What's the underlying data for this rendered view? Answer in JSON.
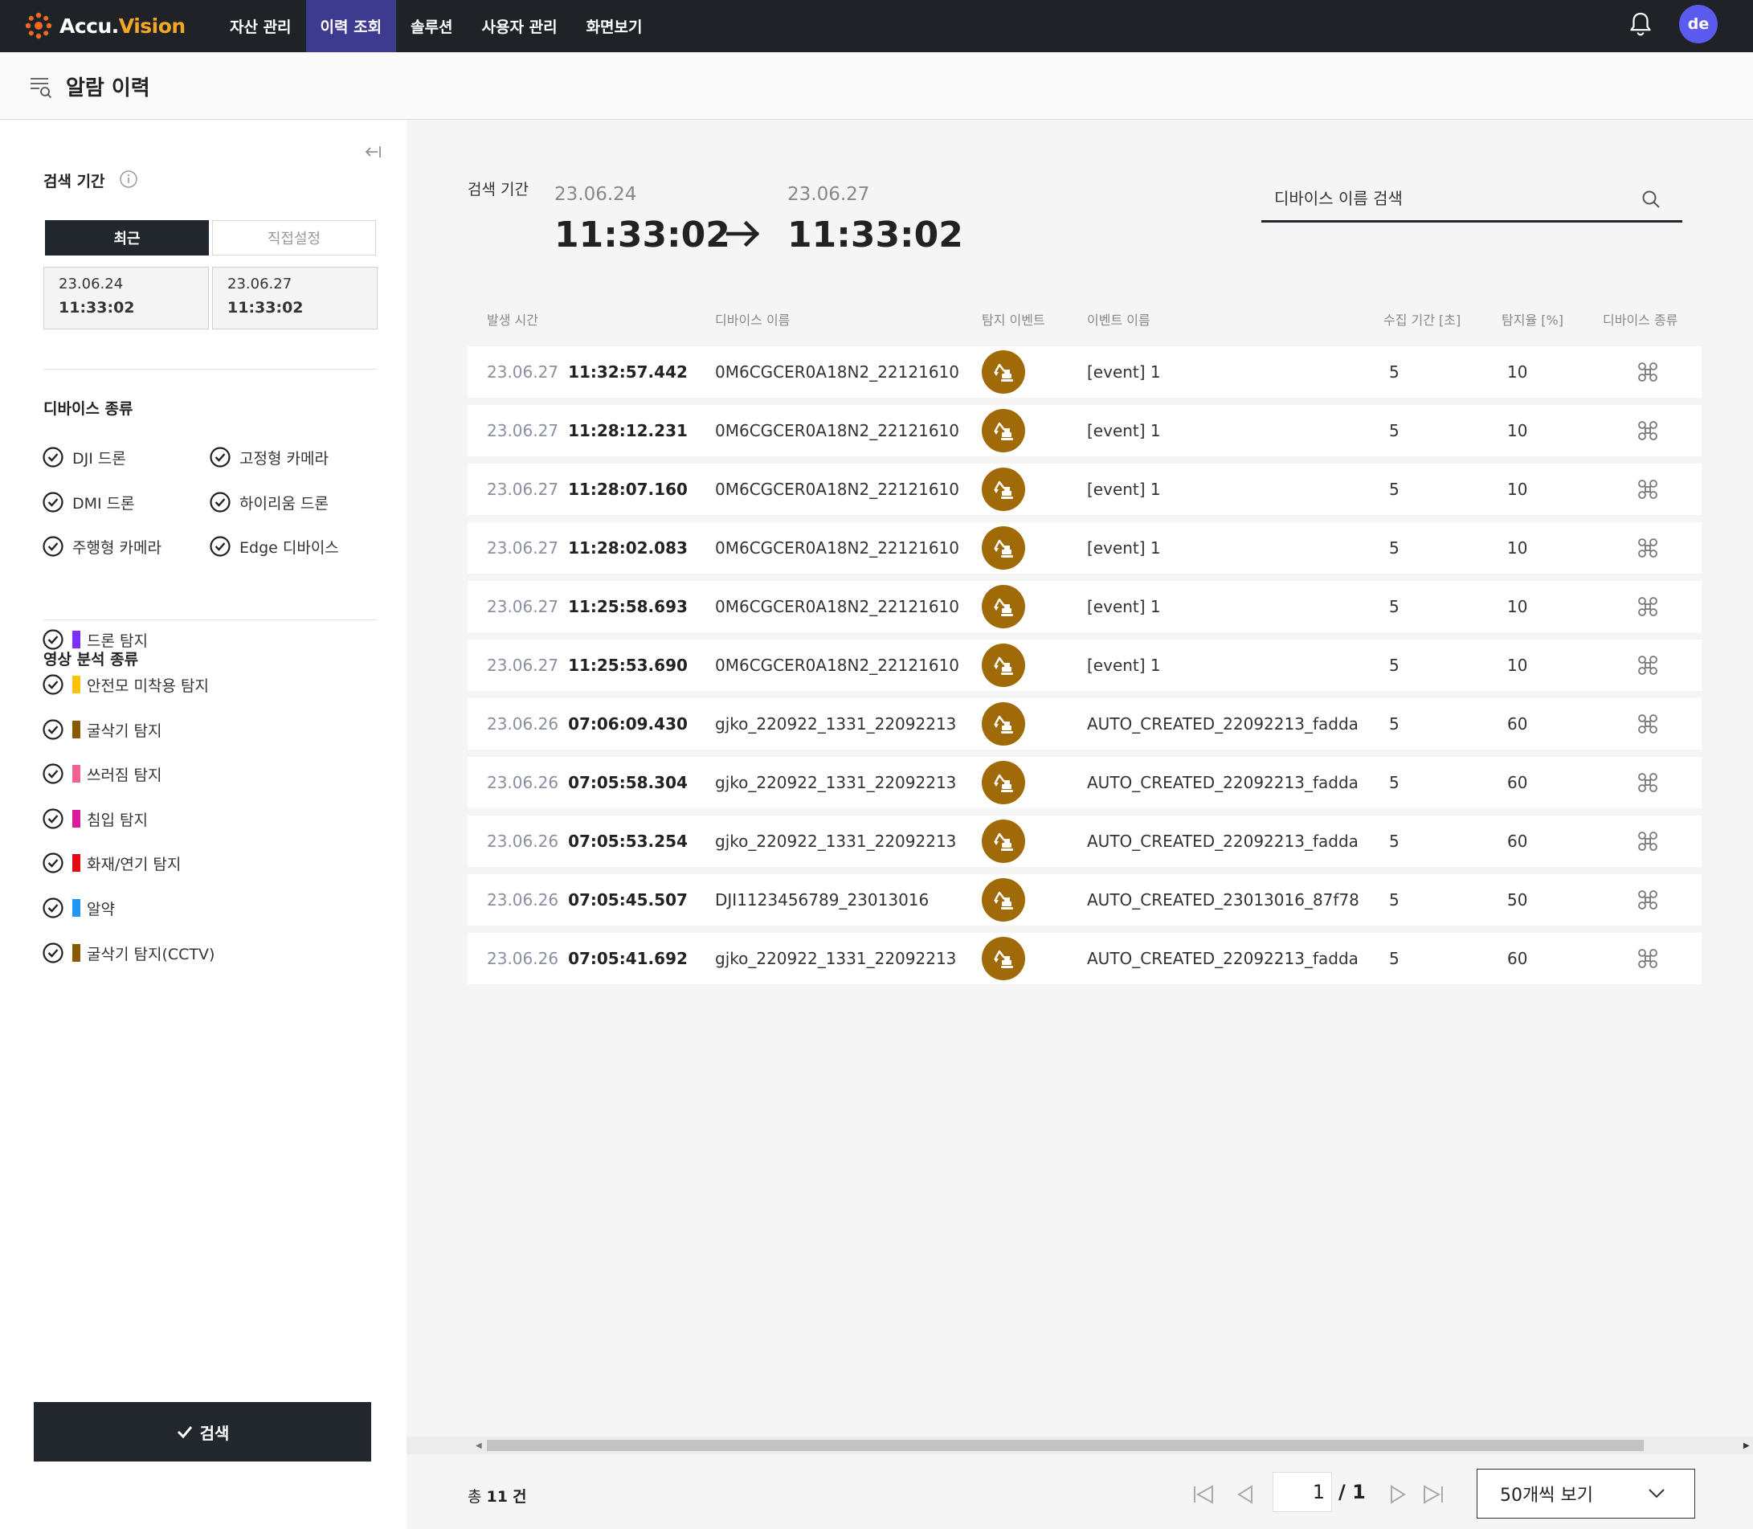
{
  "app": {
    "logo_prefix": "Accu.",
    "logo_suffix": "Vision",
    "nav": [
      "자산 관리",
      "이력 조회",
      "솔루션",
      "사용자 관리",
      "화면보기"
    ],
    "active_nav_index": 1,
    "avatar": "de"
  },
  "page": {
    "title": "알람 이력"
  },
  "sidebar": {
    "period_title": "검색 기간",
    "recent_label": "최근",
    "manual_label": "직접설정",
    "start_date": "23.06.24",
    "start_time": "11:33:02",
    "end_date": "23.06.27",
    "end_time": "11:33:02",
    "device_type_title": "디바이스 종류",
    "device_types": [
      "DJI 드론",
      "고정형 카메라",
      "DMI 드론",
      "하이리움 드론",
      "주행형 카메라",
      "Edge 디바이스"
    ],
    "analysis_title": "영상 분석 종류",
    "analysis_types": [
      {
        "label": "드론 탐지",
        "color": "#7b2ff7"
      },
      {
        "label": "안전모 미착용 탐지",
        "color": "#ffc107"
      },
      {
        "label": "굴삭기 탐지",
        "color": "#8b5a00"
      },
      {
        "label": "쓰러짐 탐지",
        "color": "#f06292"
      },
      {
        "label": "침입 탐지",
        "color": "#d81b9c"
      },
      {
        "label": "화재/연기 탐지",
        "color": "#e50914"
      },
      {
        "label": "알약",
        "color": "#2196f3"
      },
      {
        "label": "굴삭기 탐지(CCTV)",
        "color": "#8b5a00"
      }
    ],
    "search_button": "검색"
  },
  "main": {
    "period_label": "검색 기간",
    "start_date": "23.06.24",
    "start_time": "11:33:02",
    "end_date": "23.06.27",
    "end_time": "11:33:02",
    "search_placeholder": "디바이스 이름 검색",
    "columns": [
      "발생 시간",
      "디바이스 이름",
      "탐지 이벤트",
      "이벤트 이름",
      "수집 기간 [초]",
      "탐지율 [%]",
      "디바이스 종류"
    ],
    "rows": [
      {
        "date": "23.06.27",
        "time": "11:32:57.442",
        "device": "0M6CGCER0A18N2_22121610",
        "event": "[event] 1",
        "period": "5",
        "rate": "10"
      },
      {
        "date": "23.06.27",
        "time": "11:28:12.231",
        "device": "0M6CGCER0A18N2_22121610",
        "event": "[event] 1",
        "period": "5",
        "rate": "10"
      },
      {
        "date": "23.06.27",
        "time": "11:28:07.160",
        "device": "0M6CGCER0A18N2_22121610",
        "event": "[event] 1",
        "period": "5",
        "rate": "10"
      },
      {
        "date": "23.06.27",
        "time": "11:28:02.083",
        "device": "0M6CGCER0A18N2_22121610",
        "event": "[event] 1",
        "period": "5",
        "rate": "10"
      },
      {
        "date": "23.06.27",
        "time": "11:25:58.693",
        "device": "0M6CGCER0A18N2_22121610",
        "event": "[event] 1",
        "period": "5",
        "rate": "10"
      },
      {
        "date": "23.06.27",
        "time": "11:25:53.690",
        "device": "0M6CGCER0A18N2_22121610",
        "event": "[event] 1",
        "period": "5",
        "rate": "10"
      },
      {
        "date": "23.06.26",
        "time": "07:06:09.430",
        "device": "gjko_220922_1331_22092213",
        "event": "AUTO_CREATED_22092213_fadda",
        "period": "5",
        "rate": "60"
      },
      {
        "date": "23.06.26",
        "time": "07:05:58.304",
        "device": "gjko_220922_1331_22092213",
        "event": "AUTO_CREATED_22092213_fadda",
        "period": "5",
        "rate": "60"
      },
      {
        "date": "23.06.26",
        "time": "07:05:53.254",
        "device": "gjko_220922_1331_22092213",
        "event": "AUTO_CREATED_22092213_fadda",
        "period": "5",
        "rate": "60"
      },
      {
        "date": "23.06.26",
        "time": "07:05:45.507",
        "device": "DJI1123456789_23013016",
        "event": "AUTO_CREATED_23013016_87f78",
        "period": "5",
        "rate": "50"
      },
      {
        "date": "23.06.26",
        "time": "07:05:41.692",
        "device": "gjko_220922_1331_22092213",
        "event": "AUTO_CREATED_22092213_fadda",
        "period": "5",
        "rate": "60"
      }
    ],
    "total_label": "총",
    "total_count": "11",
    "total_unit": "건",
    "current_page": "1",
    "page_total": "/ 1",
    "per_page": "50개씩 보기"
  },
  "colors": {
    "topbar": "#1f2328",
    "nav_active": "#3c3b8f",
    "avatar": "#5b5bef",
    "event_badge": "#a06a08",
    "logo_accent": "#f5a623"
  },
  "icons": {
    "event": "excavator-icon",
    "device_type": "drone-icon"
  }
}
